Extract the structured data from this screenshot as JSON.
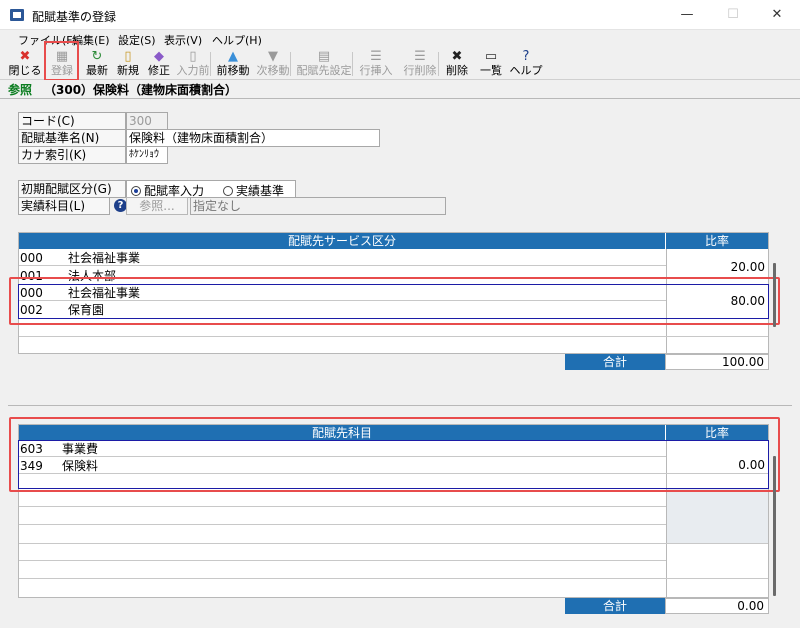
{
  "window": {
    "title": "配賦基準の登録",
    "minimize": "—",
    "maximize": "☐",
    "close": "✕"
  },
  "menu": [
    "ファイル(F)",
    "編集(E)",
    "設定(S)",
    "表示(V)",
    "ヘルプ(H)"
  ],
  "toolbar": [
    {
      "label": "閉じる",
      "icon": "close-icon",
      "glyph": "✖",
      "color": "#d9302c",
      "enabled": true
    },
    {
      "label": "登録",
      "icon": "save-icon",
      "glyph": "▦",
      "color": "#9a9a9a",
      "enabled": false
    },
    {
      "label": "最新",
      "icon": "refresh-icon",
      "glyph": "↻",
      "color": "#2e8b3a",
      "enabled": true
    },
    {
      "label": "新規",
      "icon": "new-document-icon",
      "glyph": "▯",
      "color": "#c89a2a",
      "enabled": true
    },
    {
      "label": "修正",
      "icon": "eraser-icon",
      "glyph": "◆",
      "color": "#8a5ac8",
      "enabled": true
    },
    {
      "label": "入力前",
      "icon": "undo-document-icon",
      "glyph": "▯",
      "color": "#9a9a9a",
      "enabled": false
    },
    {
      "label": "前移動",
      "icon": "arrow-up-icon",
      "glyph": "▲",
      "color": "#3a8fd8",
      "enabled": true
    },
    {
      "label": "次移動",
      "icon": "arrow-down-icon",
      "glyph": "▼",
      "color": "#9a9a9a",
      "enabled": false
    },
    {
      "label": "配賦先設定",
      "icon": "allocation-settings-icon",
      "glyph": "▤",
      "color": "#9a9a9a",
      "enabled": false
    },
    {
      "label": "行挿入",
      "icon": "insert-row-icon",
      "glyph": "☰",
      "color": "#9a9a9a",
      "enabled": false
    },
    {
      "label": "行削除",
      "icon": "delete-row-icon",
      "glyph": "☰",
      "color": "#9a9a9a",
      "enabled": false
    },
    {
      "label": "削除",
      "icon": "delete-icon",
      "glyph": "✖",
      "color": "#222222",
      "enabled": true
    },
    {
      "label": "一覧",
      "icon": "list-icon",
      "glyph": "▭",
      "color": "#333333",
      "enabled": true
    },
    {
      "label": "ヘルプ",
      "icon": "help-icon",
      "glyph": "?",
      "color": "#1d3f8a",
      "enabled": true
    }
  ],
  "header": {
    "tag": "参照",
    "title": "（300）保険料（建物床面積割合）"
  },
  "form": {
    "code_label": "コード(C)",
    "code_value": "300",
    "name_label": "配賦基準名(N)",
    "name_value": "保険料（建物床面積割合）",
    "kana_label": "カナ索引(K)",
    "kana_value": "ﾎｹﾝﾘｮｳ",
    "division_label": "初期配賦区分(G)",
    "radio_rate": "配賦率入力",
    "radio_actual": "実績基準",
    "radio_selected": "rate",
    "account_label": "実績科目(L)",
    "account_ref_button": "参照...",
    "account_value": "指定なし"
  },
  "service_grid": {
    "col_name": "配賦先サービス区分",
    "col_rate": "比率",
    "rows": [
      {
        "code1": "000",
        "name1": "社会福祉事業",
        "code2": "001",
        "name2": "法人本部",
        "rate": "20.00"
      },
      {
        "code1": "000",
        "name1": "社会福祉事業",
        "code2": "002",
        "name2": "保育園",
        "rate": "80.00"
      }
    ],
    "total_label": "合計",
    "total_value": "100.00"
  },
  "account_grid": {
    "col_name": "配賦先科目",
    "col_rate": "比率",
    "rows": [
      {
        "code1": "603",
        "name1": "事業費",
        "code2": "349",
        "name2": "保険料",
        "rate": "0.00"
      }
    ],
    "total_label": "合計",
    "total_value": "0.00"
  },
  "colors": {
    "header_blue": "#1f6fb2",
    "highlight_red": "#e84c4c",
    "select_navy": "#1c1ca6",
    "reference_green": "#0b7d20"
  }
}
